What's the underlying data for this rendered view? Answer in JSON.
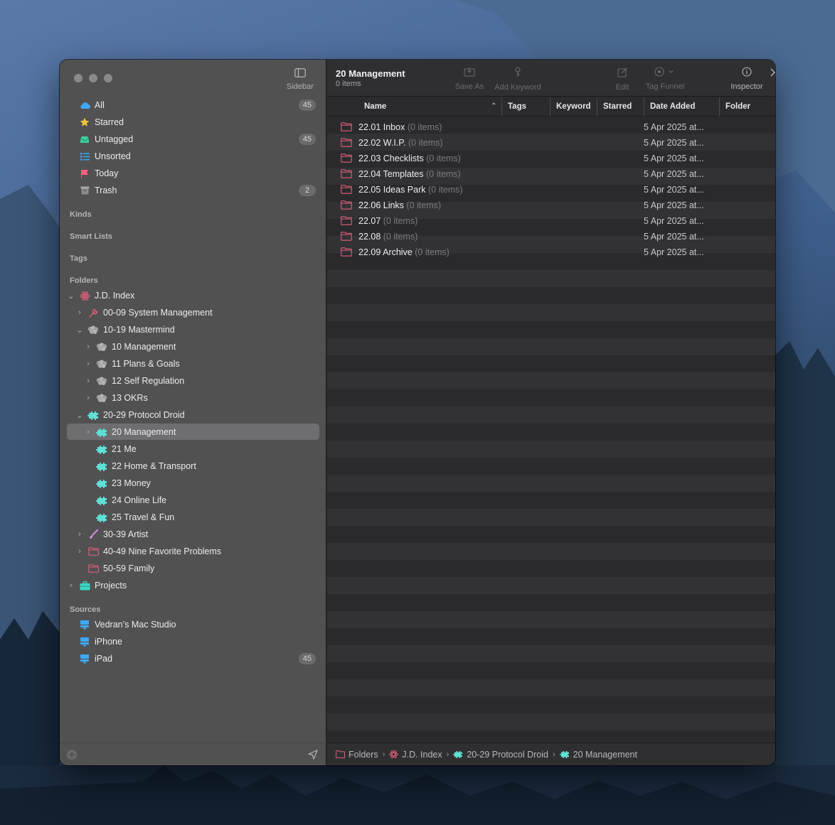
{
  "window": {
    "sidebar_toggle_label": "Sidebar"
  },
  "sidebar": {
    "library": [
      {
        "label": "All",
        "badge": "45",
        "icon": "cloud-icon"
      },
      {
        "label": "Starred",
        "badge": "",
        "icon": "star-icon"
      },
      {
        "label": "Untagged",
        "badge": "45",
        "icon": "tray-icon"
      },
      {
        "label": "Unsorted",
        "badge": "",
        "icon": "list-icon"
      },
      {
        "label": "Today",
        "badge": "",
        "icon": "flag-icon"
      },
      {
        "label": "Trash",
        "badge": "2",
        "icon": "trash-icon"
      }
    ],
    "sections": {
      "kinds": "Kinds",
      "smart_lists": "Smart Lists",
      "tags": "Tags",
      "folders": "Folders",
      "sources": "Sources"
    },
    "folders": [
      {
        "label": "J.D. Index",
        "icon": "atom-icon"
      },
      {
        "label": "00-09 System Management",
        "icon": "wrench-icon"
      },
      {
        "label": "10-19 Mastermind",
        "icon": "brain-icon"
      },
      {
        "label": "10 Management",
        "icon": "brain-icon"
      },
      {
        "label": "11 Plans & Goals",
        "icon": "brain-icon"
      },
      {
        "label": "12 Self Regulation",
        "icon": "brain-icon"
      },
      {
        "label": "13 OKRs",
        "icon": "brain-icon"
      },
      {
        "label": "20-29 Protocol Droid",
        "icon": "puzzle-icon"
      },
      {
        "label": "20 Management",
        "icon": "puzzle-icon"
      },
      {
        "label": "21 Me",
        "icon": "puzzle-icon"
      },
      {
        "label": "22 Home & Transport",
        "icon": "puzzle-icon"
      },
      {
        "label": "23 Money",
        "icon": "puzzle-icon"
      },
      {
        "label": "24 Online Life",
        "icon": "puzzle-icon"
      },
      {
        "label": "25 Travel & Fun",
        "icon": "puzzle-icon"
      },
      {
        "label": "30-39 Artist",
        "icon": "brush-icon"
      },
      {
        "label": "40-49 Nine Favorite Problems",
        "icon": "folder-icon"
      },
      {
        "label": "50-59 Family",
        "icon": "folder-icon"
      },
      {
        "label": "Projects",
        "icon": "briefcase-icon"
      }
    ],
    "sources": [
      {
        "label": "Vedran’s Mac Studio",
        "badge": "",
        "icon": "device-icon"
      },
      {
        "label": "iPhone",
        "badge": "",
        "icon": "device-icon"
      },
      {
        "label": "iPad",
        "badge": "45",
        "icon": "device-icon"
      }
    ]
  },
  "toolbar": {
    "title": "20 Management",
    "subtitle": "0 items",
    "save_as": "Save As",
    "add_keyword": "Add Keyword",
    "edit": "Edit",
    "tag_funnel": "Tag Funnel",
    "inspector": "Inspector"
  },
  "columns": [
    "Name",
    "Tags",
    "Keyword",
    "Starred",
    "Date Added",
    "Folder"
  ],
  "files": [
    {
      "name": "22.01 Inbox",
      "count": "(0 items)",
      "date": "5 Apr 2025 at..."
    },
    {
      "name": "22.02 W.I.P.",
      "count": "(0 items)",
      "date": "5 Apr 2025 at..."
    },
    {
      "name": "22.03 Checklists",
      "count": "(0 items)",
      "date": "5 Apr 2025 at..."
    },
    {
      "name": "22.04 Templates",
      "count": "(0 items)",
      "date": "5 Apr 2025 at..."
    },
    {
      "name": "22.05 Ideas Park",
      "count": "(0 items)",
      "date": "5 Apr 2025 at..."
    },
    {
      "name": "22.06 Links",
      "count": "(0 items)",
      "date": "5 Apr 2025 at..."
    },
    {
      "name": "22.07",
      "count": "(0 items)",
      "date": "5 Apr 2025 at..."
    },
    {
      "name": "22.08",
      "count": "(0 items)",
      "date": "5 Apr 2025 at..."
    },
    {
      "name": "22.09 Archive",
      "count": "(0 items)",
      "date": "5 Apr 2025 at..."
    }
  ],
  "path_bar": [
    "Folders",
    "J.D. Index",
    "20-29 Protocol Droid",
    "20 Management"
  ],
  "colors": {
    "folder_pink": "#e0607a",
    "puzzle_teal": "#5fe0d6",
    "cloud_blue": "#3fa9f5",
    "star_yellow": "#f5c33b"
  }
}
